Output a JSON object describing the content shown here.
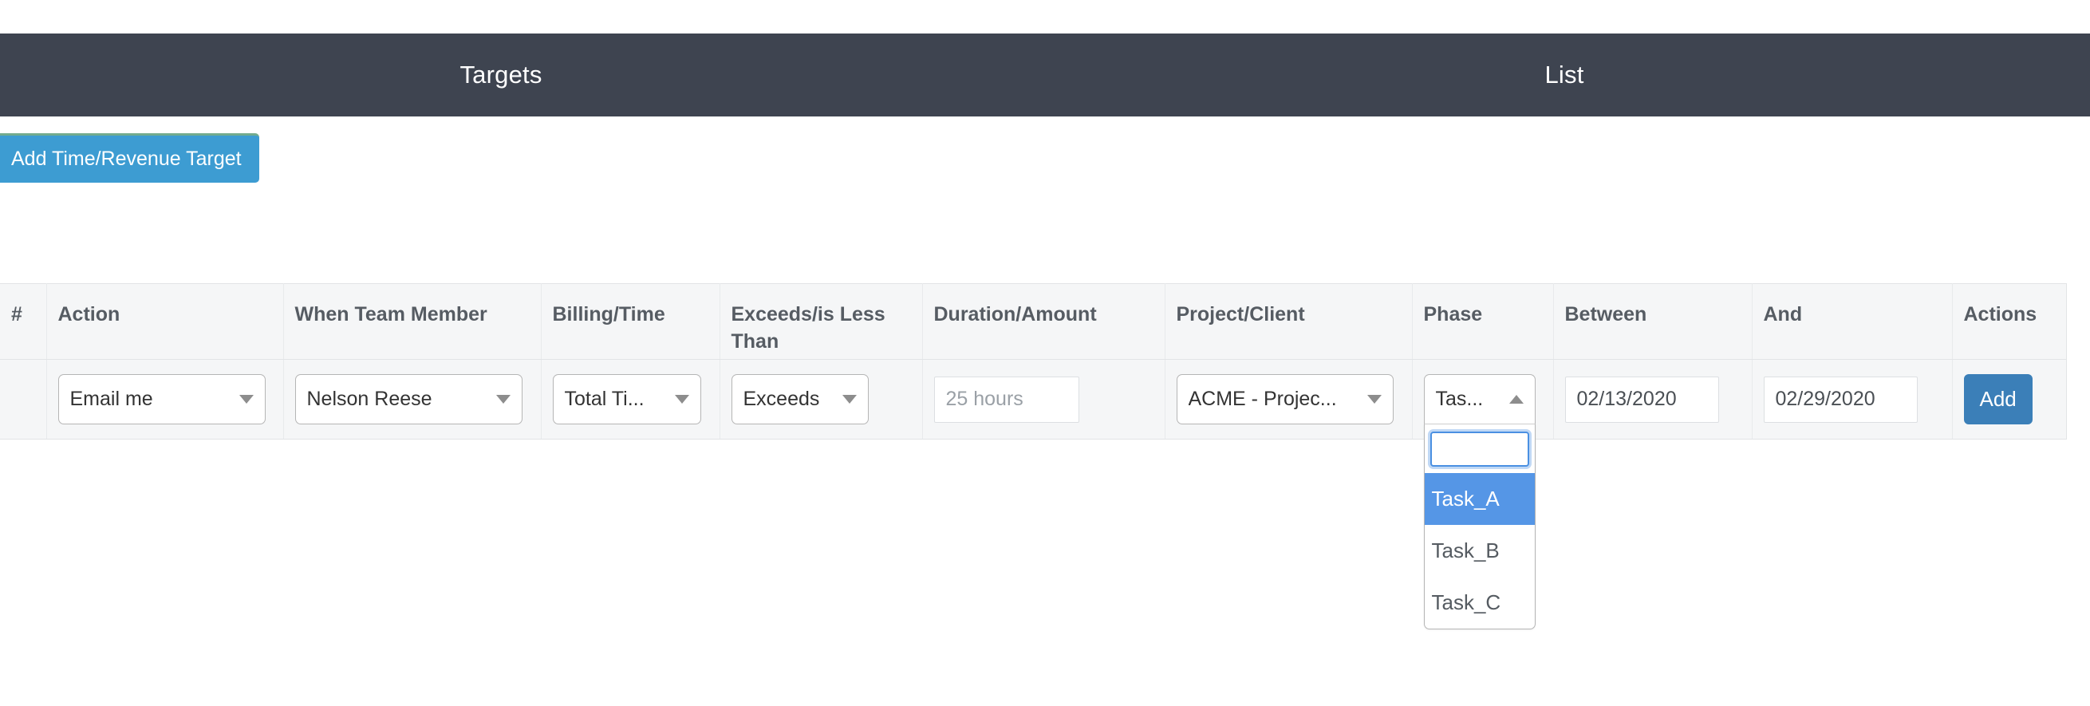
{
  "navbar": {
    "tabs": [
      {
        "label": "Targets"
      },
      {
        "label": "List"
      }
    ]
  },
  "toolbar": {
    "add_target_label": "Add Time/Revenue Target"
  },
  "table": {
    "headers": [
      "#",
      "Action",
      "When Team Member",
      "Billing/Time",
      "Exceeds/is Less Than",
      "Duration/Amount",
      "Project/Client",
      "Phase",
      "Between",
      "And",
      "Actions"
    ],
    "row": {
      "index": "",
      "action": {
        "value": "Email me"
      },
      "team_member": {
        "value": "Nelson Reese"
      },
      "billing_time": {
        "value": "Total Ti..."
      },
      "exceeds": {
        "value": "Exceeds"
      },
      "duration": {
        "value": "",
        "placeholder": "25 hours"
      },
      "project_client": {
        "value": "ACME - Projec..."
      },
      "phase": {
        "value": "Tas...",
        "open": true,
        "search_value": "",
        "options": [
          {
            "label": "Task_A",
            "selected": true
          },
          {
            "label": "Task_B",
            "selected": false
          },
          {
            "label": "Task_C",
            "selected": false
          }
        ]
      },
      "between": {
        "value": "02/13/2020"
      },
      "and": {
        "value": "02/29/2020"
      },
      "add_label": "Add"
    }
  },
  "colors": {
    "navbar_bg": "#3e4450",
    "primary_blue": "#3d9cd2",
    "add_button_blue": "#3b7fb8",
    "highlight_blue": "#5596e6",
    "header_bg": "#f5f6f7",
    "accent_green": "#72ab8e"
  }
}
